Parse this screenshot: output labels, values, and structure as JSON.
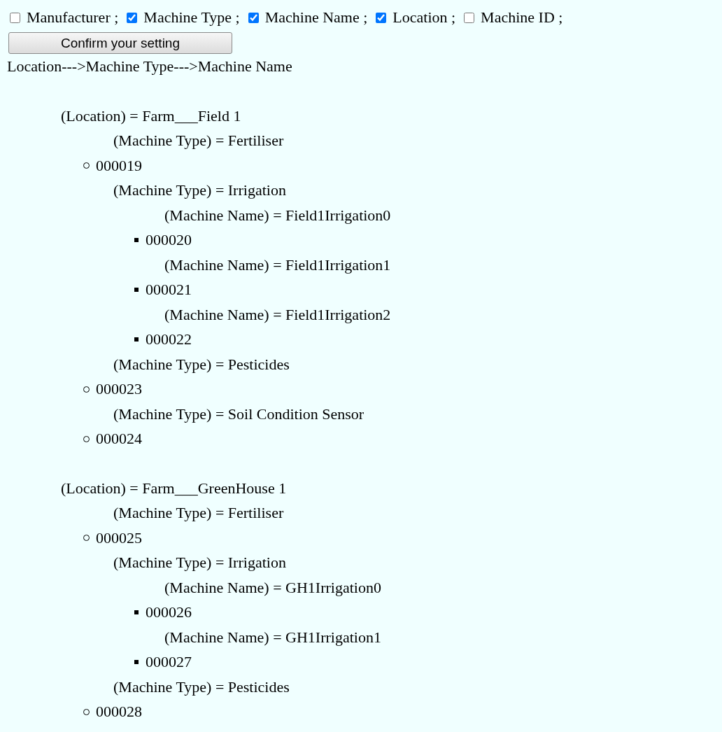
{
  "fields": [
    {
      "label": "Manufacturer ;",
      "checked": false
    },
    {
      "label": "Machine Type ;",
      "checked": true
    },
    {
      "label": "Machine Name ;",
      "checked": true
    },
    {
      "label": "Location ;",
      "checked": true
    },
    {
      "label": "Machine ID ;",
      "checked": false
    }
  ],
  "confirm_button": "Confirm your setting",
  "grouping_path": "Location--->Machine Type--->Machine Name",
  "tree": [
    {
      "kind": "group",
      "label": "(Location) = Farm___Field 1",
      "children": [
        {
          "kind": "group",
          "label": "(Machine Type) = Fertiliser",
          "children": [
            {
              "kind": "item",
              "label": "000019"
            }
          ]
        },
        {
          "kind": "group",
          "label": "(Machine Type) = Irrigation",
          "children": [
            {
              "kind": "group",
              "label": "(Machine Name) = Field1Irrigation0",
              "children": [
                {
                  "kind": "item",
                  "label": "000020"
                }
              ]
            },
            {
              "kind": "group",
              "label": "(Machine Name) = Field1Irrigation1",
              "children": [
                {
                  "kind": "item",
                  "label": "000021"
                }
              ]
            },
            {
              "kind": "group",
              "label": "(Machine Name) = Field1Irrigation2",
              "children": [
                {
                  "kind": "item",
                  "label": "000022"
                }
              ]
            }
          ]
        },
        {
          "kind": "group",
          "label": "(Machine Type) = Pesticides",
          "children": [
            {
              "kind": "item",
              "label": "000023"
            }
          ]
        },
        {
          "kind": "group",
          "label": "(Machine Type) = Soil Condition Sensor",
          "children": [
            {
              "kind": "item",
              "label": "000024"
            }
          ]
        }
      ]
    },
    {
      "kind": "group",
      "label": "(Location) = Farm___GreenHouse 1",
      "children": [
        {
          "kind": "group",
          "label": "(Machine Type) = Fertiliser",
          "children": [
            {
              "kind": "item",
              "label": "000025"
            }
          ]
        },
        {
          "kind": "group",
          "label": "(Machine Type) = Irrigation",
          "children": [
            {
              "kind": "group",
              "label": "(Machine Name) = GH1Irrigation0",
              "children": [
                {
                  "kind": "item",
                  "label": "000026"
                }
              ]
            },
            {
              "kind": "group",
              "label": "(Machine Name) = GH1Irrigation1",
              "children": [
                {
                  "kind": "item",
                  "label": "000027"
                }
              ]
            }
          ]
        },
        {
          "kind": "group",
          "label": "(Machine Type) = Pesticides",
          "children": [
            {
              "kind": "item",
              "label": "000028"
            }
          ]
        }
      ]
    }
  ]
}
